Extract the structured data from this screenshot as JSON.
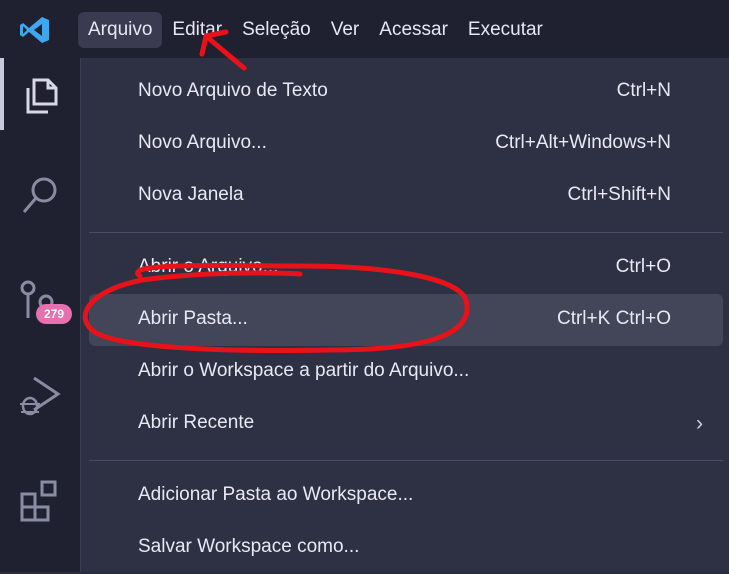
{
  "menubar": {
    "items": [
      {
        "label": "Arquivo",
        "active": true
      },
      {
        "label": "Editar"
      },
      {
        "label": "Seleção"
      },
      {
        "label": "Ver"
      },
      {
        "label": "Acessar"
      },
      {
        "label": "Executar"
      }
    ]
  },
  "activitybar": {
    "items": [
      {
        "icon": "explorer-files-icon",
        "active": true
      },
      {
        "icon": "search-icon"
      },
      {
        "icon": "source-control-icon",
        "badge": "279"
      },
      {
        "icon": "run-debug-icon"
      },
      {
        "icon": "extensions-icon"
      }
    ]
  },
  "file_menu": {
    "new_text_file": {
      "label": "Novo Arquivo de Texto",
      "shortcut": "Ctrl+N"
    },
    "new_file": {
      "label": "Novo Arquivo...",
      "shortcut": "Ctrl+Alt+Windows+N"
    },
    "new_window": {
      "label": "Nova Janela",
      "shortcut": "Ctrl+Shift+N"
    },
    "open_file": {
      "label": "Abrir o Arquivo...",
      "shortcut": "Ctrl+O"
    },
    "open_folder": {
      "label": "Abrir Pasta...",
      "shortcut": "Ctrl+K Ctrl+O"
    },
    "open_workspace": {
      "label": "Abrir o Workspace a partir do Arquivo..."
    },
    "open_recent": {
      "label": "Abrir Recente",
      "submenu_icon": "chevron-right-icon"
    },
    "add_folder_workspace": {
      "label": "Adicionar Pasta ao Workspace..."
    },
    "save_workspace_as": {
      "label": "Salvar Workspace como..."
    }
  },
  "colors": {
    "accent_blue": "#3fa6f0",
    "annotation_red": "#e8121a",
    "badge_pink": "#e86fb0",
    "menu_background": "#2e3043",
    "hover_row": "#434559"
  }
}
